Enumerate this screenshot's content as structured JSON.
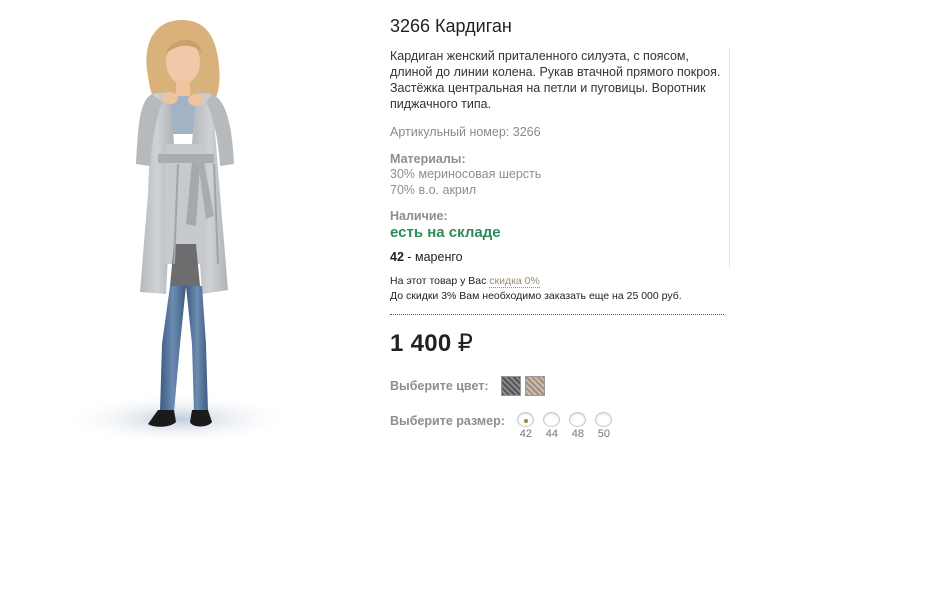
{
  "product": {
    "title": "3266 Кардиган",
    "description": "Кардиган женский приталенного силуэта, с поясом, длиной до линии колена. Рукав втачной прямого покроя. Застёжка центральная на петли и пуговицы. Воротник пиджачного типа.",
    "article": "Артикульный номер: 3266",
    "materials_heading": "Материалы:",
    "materials": [
      "30% мериносовая шерсть",
      "70% в.о. акрил"
    ],
    "availability_heading": "Наличие:",
    "availability": "есть на складе",
    "variant_size": "42",
    "variant_sep": " - ",
    "variant_color": "маренго",
    "discount_text": "На этот товар у Вас",
    "discount_link": "скидка 0%",
    "discount_hint": "До скидки 3% Вам необходимо заказать еще на 25 000 руб.",
    "price": "1 400",
    "currency": "₽"
  },
  "options": {
    "color_label": "Выберите цвет:",
    "colors": [
      {
        "name": "маренго",
        "hex": "#6f6f6f"
      },
      {
        "name": "бежевый меланж",
        "hex": "#b8a898"
      }
    ],
    "size_label": "Выберите размер:",
    "sizes": [
      "42",
      "44",
      "48",
      "50"
    ],
    "selected_size": "42"
  },
  "photo": {
    "alt_icon": "product-photo-woman-in-cardigan"
  }
}
